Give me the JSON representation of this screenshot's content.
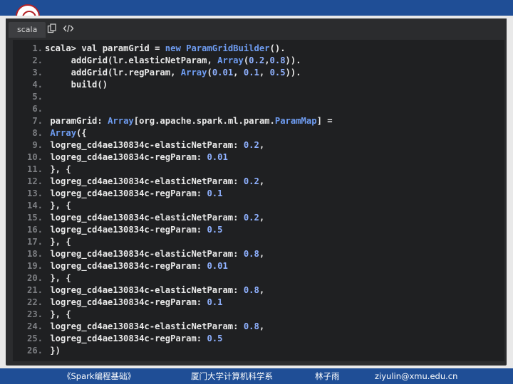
{
  "toolbar": {
    "language_tab": "scala",
    "copy_icon": "copy-icon",
    "code_icon": "code-icon"
  },
  "colors": {
    "header_bar": "#1f4e96",
    "editor_bg": "#2b2c2e",
    "code_bg": "#1f2022",
    "keyword": "#6f9df2",
    "number": "#8fb1ff",
    "line_number": "#7c7e82"
  },
  "code": {
    "lines": [
      {
        "n": "1.",
        "segs": [
          [
            "scala> val paramGrid = ",
            "t"
          ],
          [
            "new",
            "k"
          ],
          [
            " ",
            "t"
          ],
          [
            "ParamGridBuilder",
            "k"
          ],
          [
            "().",
            "t"
          ]
        ]
      },
      {
        "n": "2.",
        "segs": [
          [
            "     addGrid(lr.elasticNetParam, ",
            "t"
          ],
          [
            "Array",
            "k"
          ],
          [
            "(",
            "t"
          ],
          [
            "0.2",
            "v"
          ],
          [
            ",",
            "t"
          ],
          [
            "0.8",
            "v"
          ],
          [
            ")).",
            "t"
          ]
        ]
      },
      {
        "n": "3.",
        "segs": [
          [
            "     addGrid(lr.regParam, ",
            "t"
          ],
          [
            "Array",
            "k"
          ],
          [
            "(",
            "t"
          ],
          [
            "0.01",
            "v"
          ],
          [
            ", ",
            "t"
          ],
          [
            "0.1",
            "v"
          ],
          [
            ", ",
            "t"
          ],
          [
            "0.5",
            "v"
          ],
          [
            ")).",
            "t"
          ]
        ]
      },
      {
        "n": "4.",
        "segs": [
          [
            "     build()",
            "t"
          ]
        ]
      },
      {
        "n": "5.",
        "segs": []
      },
      {
        "n": "6.",
        "segs": []
      },
      {
        "n": "7.",
        "segs": [
          [
            " paramGrid: ",
            "t"
          ],
          [
            "Array",
            "k"
          ],
          [
            "[org.apache.spark.ml.param.",
            "t"
          ],
          [
            "ParamMap",
            "k"
          ],
          [
            "] =",
            "t"
          ]
        ]
      },
      {
        "n": "8.",
        "segs": [
          [
            " ",
            "t"
          ],
          [
            "Array",
            "k"
          ],
          [
            "({",
            "t"
          ]
        ]
      },
      {
        "n": "9.",
        "segs": [
          [
            " logreg_cd4ae130834c-elasticNetParam: ",
            "t"
          ],
          [
            "0.2",
            "v"
          ],
          [
            ",",
            "t"
          ]
        ]
      },
      {
        "n": "10.",
        "segs": [
          [
            " logreg_cd4ae130834c-regParam: ",
            "t"
          ],
          [
            "0.01",
            "v"
          ]
        ]
      },
      {
        "n": "11.",
        "segs": [
          [
            " }, {",
            "t"
          ]
        ]
      },
      {
        "n": "12.",
        "segs": [
          [
            " logreg_cd4ae130834c-elasticNetParam: ",
            "t"
          ],
          [
            "0.2",
            "v"
          ],
          [
            ",",
            "t"
          ]
        ]
      },
      {
        "n": "13.",
        "segs": [
          [
            " logreg_cd4ae130834c-regParam: ",
            "t"
          ],
          [
            "0.1",
            "v"
          ]
        ]
      },
      {
        "n": "14.",
        "segs": [
          [
            " }, {",
            "t"
          ]
        ]
      },
      {
        "n": "15.",
        "segs": [
          [
            " logreg_cd4ae130834c-elasticNetParam: ",
            "t"
          ],
          [
            "0.2",
            "v"
          ],
          [
            ",",
            "t"
          ]
        ]
      },
      {
        "n": "16.",
        "segs": [
          [
            " logreg_cd4ae130834c-regParam: ",
            "t"
          ],
          [
            "0.5",
            "v"
          ]
        ]
      },
      {
        "n": "17.",
        "segs": [
          [
            " }, {",
            "t"
          ]
        ]
      },
      {
        "n": "18.",
        "segs": [
          [
            " logreg_cd4ae130834c-elasticNetParam: ",
            "t"
          ],
          [
            "0.8",
            "v"
          ],
          [
            ",",
            "t"
          ]
        ]
      },
      {
        "n": "19.",
        "segs": [
          [
            " logreg_cd4ae130834c-regParam: ",
            "t"
          ],
          [
            "0.01",
            "v"
          ]
        ]
      },
      {
        "n": "20.",
        "segs": [
          [
            " }, {",
            "t"
          ]
        ]
      },
      {
        "n": "21.",
        "segs": [
          [
            " logreg_cd4ae130834c-elasticNetParam: ",
            "t"
          ],
          [
            "0.8",
            "v"
          ],
          [
            ",",
            "t"
          ]
        ]
      },
      {
        "n": "22.",
        "segs": [
          [
            " logreg_cd4ae130834c-regParam: ",
            "t"
          ],
          [
            "0.1",
            "v"
          ]
        ]
      },
      {
        "n": "23.",
        "segs": [
          [
            " }, {",
            "t"
          ]
        ]
      },
      {
        "n": "24.",
        "segs": [
          [
            " logreg_cd4ae130834c-elasticNetParam: ",
            "t"
          ],
          [
            "0.8",
            "v"
          ],
          [
            ",",
            "t"
          ]
        ]
      },
      {
        "n": "25.",
        "segs": [
          [
            " logreg_cd4ae130834c-regParam: ",
            "t"
          ],
          [
            "0.5",
            "v"
          ]
        ]
      },
      {
        "n": "26.",
        "segs": [
          [
            " })",
            "t"
          ]
        ]
      }
    ]
  },
  "footer": {
    "course": "《Spark编程基础》",
    "department": "厦门大学计算机科学系",
    "author": "林子雨",
    "email": "ziyulin@xmu.edu.cn"
  }
}
